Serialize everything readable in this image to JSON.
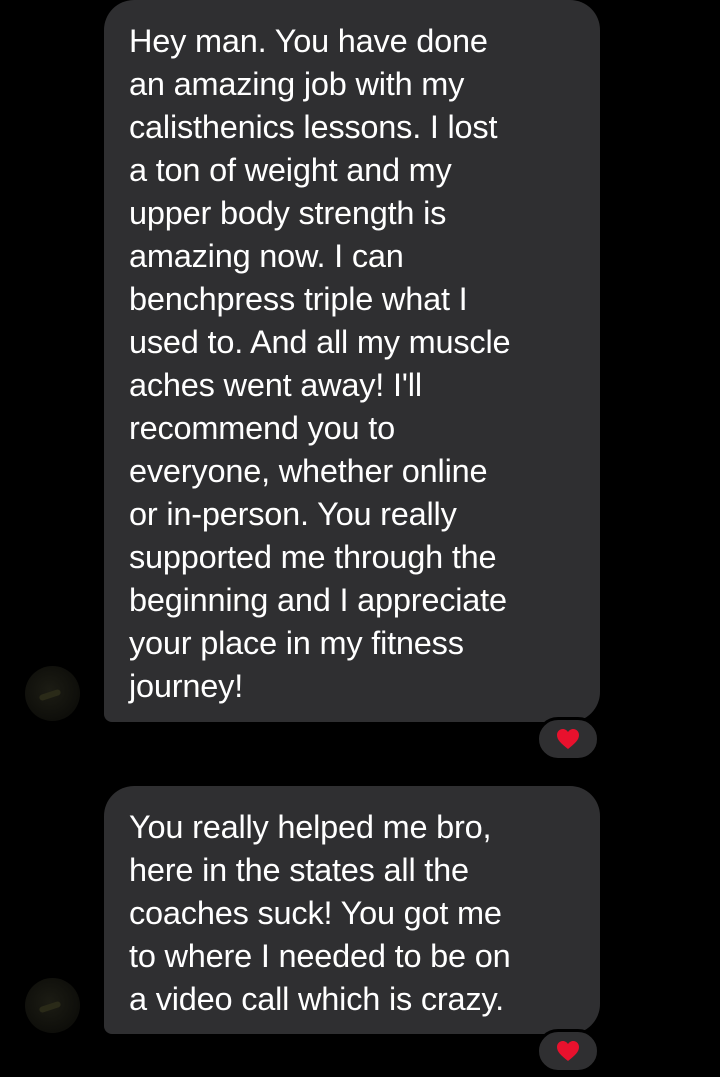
{
  "conversation": {
    "messages": [
      {
        "text": "Hey man. You have done\nan amazing job with my\ncalisthenics lessons. I lost\na ton of weight and my\nupper body strength is\namazing now. I can\nbenchpress triple what I\nused to. And all my muscle\naches went away! I'll\nrecommend you to\neveryone, whether online\nor in-person. You really\nsupported me through the\nbeginning and I appreciate\nyour place in my fitness\njourney!",
        "reaction_icon": "heart-reaction-icon",
        "reaction_color": "#e8112d"
      },
      {
        "text": "You really helped me bro,\nhere in the states all the\ncoaches suck! You got me\nto where I needed to be on\na video call which is crazy.",
        "reaction_icon": "heart-reaction-icon",
        "reaction_color": "#e8112d"
      }
    ]
  },
  "colors": {
    "background": "#000000",
    "bubble": "#2f2f31",
    "text": "#ffffff",
    "heart": "#e8112d"
  }
}
